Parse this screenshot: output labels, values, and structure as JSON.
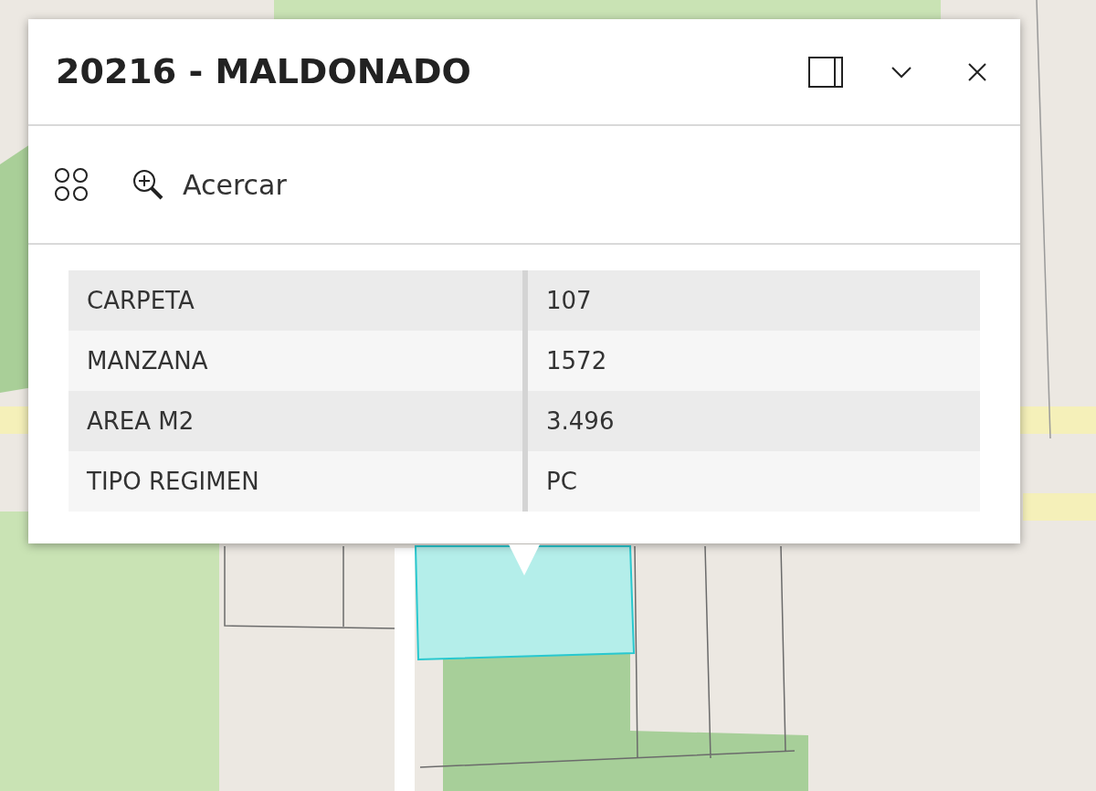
{
  "popup": {
    "title": "20216 - MALDONADO",
    "actions": [
      {
        "label": "Acercar"
      }
    ],
    "fields": [
      {
        "name": "CARPETA",
        "value": "107"
      },
      {
        "name": "MANZANA",
        "value": "1572"
      },
      {
        "name": "AREA M2",
        "value": "3.496"
      },
      {
        "name": "TIPO REGIMEN",
        "value": "PC"
      }
    ]
  }
}
